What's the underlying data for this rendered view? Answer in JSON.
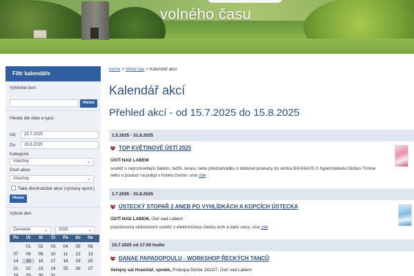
{
  "banner": {
    "subtitle": "volného času"
  },
  "sidebar": {
    "title": "Filtr kalendáře",
    "search_label": "Vyhledat text:",
    "search_value": "",
    "search_button": "Hledat",
    "date_type_label": "Hledat dle data a typu:",
    "from_label": "Od",
    "from_value": "15.7.2025",
    "to_label": "Do",
    "to_value": "15.8.2025",
    "category_label": "Kategorie",
    "category_value": "Všechny",
    "type_label": "Druh akce",
    "type_value": "Všechny",
    "long_term_label": "Také dlouhodobé akce (výstavy apod.)",
    "filter_button": "Hledat",
    "pick_day_label": "Vybrat den",
    "month_value": "Červenec",
    "year_value": "2025",
    "weekdays": [
      "Po",
      "Út",
      "St",
      "Čt",
      "Pá",
      "So",
      "Ne"
    ],
    "weeks": [
      [
        "",
        "01",
        "02",
        "03",
        "04",
        "05",
        "06"
      ],
      [
        "07",
        "08",
        "09",
        "10",
        "11",
        "12",
        "13"
      ],
      [
        "14",
        "15",
        "16",
        "17",
        "18",
        "19",
        "20"
      ],
      [
        "21",
        "22",
        "23",
        "24",
        "25",
        "26",
        "27"
      ],
      [
        "28",
        "29",
        "30",
        "31",
        "",
        "",
        ""
      ]
    ],
    "today_label": "15"
  },
  "breadcrumb": {
    "home": "home",
    "sep1": " > ",
    "section": "Volný čas",
    "sep2": " > ",
    "current": "Kalendář akcí"
  },
  "main": {
    "title": "Kalendář akcí",
    "subtitle": "Přehled akcí - od 15.7.2025 do 15.8.2025",
    "events": [
      {
        "date": "1.5.2025 - 31.8.2025",
        "title": "TOP KVĚTINOVÉ ÚSTÍ 2025",
        "location_bold": "ÚSTÍ NAD LABEM",
        "location_rest": "",
        "desc": "soutěž o nejrozkvetlejší balkón, lodžii, terasu nebo předzahrádku o dárkové poukazy do centra BAUHAUS či hypermarketu Globus Trmice nebo o poukaz na pobyt v hotelu Ostrov; více",
        "more": "zde"
      },
      {
        "date": "1.7.2025 - 31.8.2025",
        "title": "ÚSTECKÝ STOPAŘ 2 ANEB PO VYHLÍDKÁCH A KOPCÍCH ÚSTECKA",
        "location_bold": "ÚSTÍ NAD LABEM,",
        "location_rest": " Ústí nad Labem",
        "desc": "prázdninová vědomostní soutěž o elektronickou čtečku knih a další ceny; více",
        "more": "zde"
      },
      {
        "date": "15.7.2025 od 17:00 hodin",
        "title": "DANAE PAPADOPOULU - WORKSHOP ŘECKÝCH TANCŮ",
        "location_bold": "Veřejný sál Hraničář, spolek,",
        "location_rest": " Prokopa Diviše 1812/7, Ústí nad Labem",
        "desc": "",
        "more": ""
      }
    ]
  },
  "colors": {
    "accent": "#2f5fa0",
    "heading": "#2b4e7e",
    "date_bar": "#dfe6ef",
    "sidebar_bg": "#edf1f6"
  }
}
